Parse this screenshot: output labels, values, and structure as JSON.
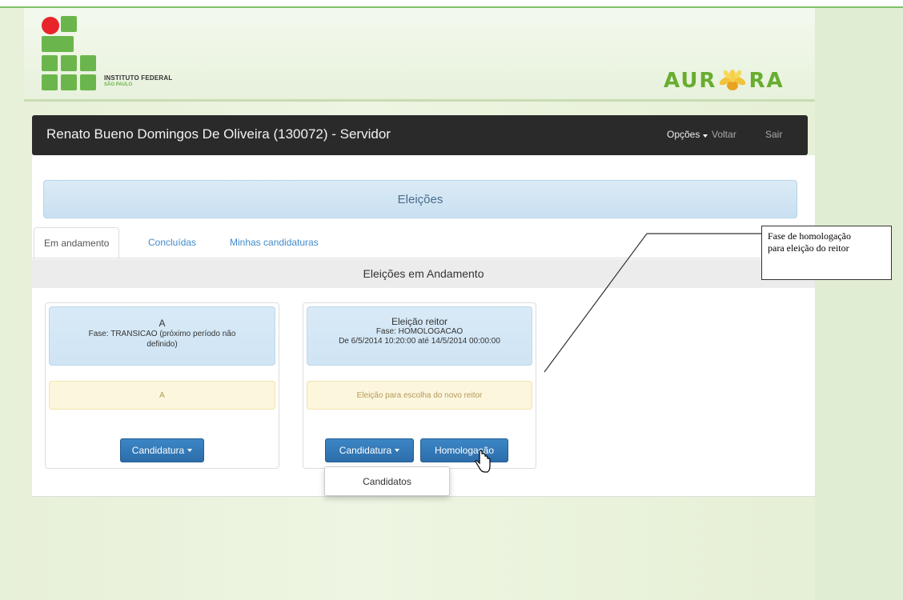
{
  "header": {
    "logo_line1": "INSTITUTO FEDERAL",
    "logo_line2": "SÃO PAULO",
    "brand_left": "AUR",
    "brand_right": "RA"
  },
  "navbar": {
    "user": "Renato Bueno Domingos De Oliveira (130072) - Servidor",
    "opcoes": "Opções",
    "voltar": "Voltar",
    "sair": "Sair"
  },
  "page": {
    "heading": "Eleições",
    "tabs": [
      {
        "label": "Em andamento",
        "active": true
      },
      {
        "label": "Concluídas",
        "active": false
      },
      {
        "label": "Minhas candidaturas",
        "active": false
      }
    ],
    "section_title": "Eleições em Andamento"
  },
  "elections": [
    {
      "title": "A",
      "phase": "Fase: TRANSICAO (próximo período não definido)",
      "description": "A",
      "buttons": [
        "Candidatura"
      ]
    },
    {
      "title": "Eleição reitor",
      "phase": "Fase: HOMOLOGACAO",
      "period": "De 6/5/2014 10:20:00 até 14/5/2014 00:00:00",
      "description": "Eleição para escolha do novo reitor",
      "buttons": [
        "Candidatura",
        "Homologação"
      ]
    }
  ],
  "dropdown": {
    "items": [
      "Candidatos"
    ]
  },
  "annotation": {
    "line1": "Fase de homologação",
    "line2": "para eleição do reitor"
  },
  "colors": {
    "navbar": "#2a2a2a",
    "button": "#2f74b4",
    "panel_head": "#d4e7f5",
    "panel_body": "#fcf6dd",
    "logo_green": "#6bb64c",
    "logo_red": "#e8242a"
  }
}
